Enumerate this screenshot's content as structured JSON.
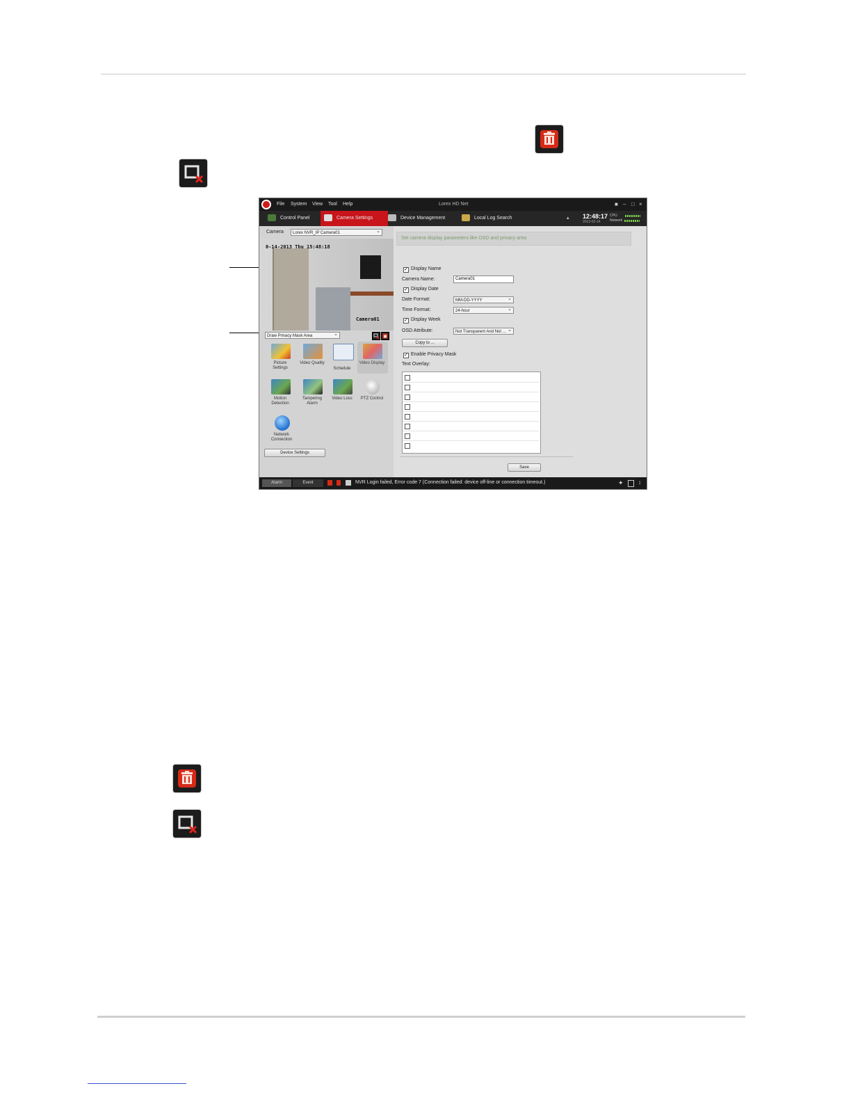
{
  "window": {
    "menu": [
      "File",
      "System",
      "View",
      "Tool",
      "Help"
    ],
    "title": "Lorex HD Net"
  },
  "nav": {
    "tabs": [
      "Control Panel",
      "Camera Settings",
      "Device Management",
      "Local Log Search"
    ],
    "active_tab": "Camera Settings",
    "clock": "12:48:17",
    "date": "2013-02-14",
    "cpu_label": "CPU",
    "network_label": "Network"
  },
  "left": {
    "camera_label": "Camera",
    "camera_value": "Lorex NVR_IP Camera01",
    "osd_timestamp": "0-14-2013 Thu 15:48:18",
    "osd_camera_name": "Camera01",
    "draw_mode": "Draw Privacy Mask Area",
    "tiles": [
      "Picture Settings",
      "Video Quality",
      "Schedule",
      "Video Display",
      "Motion Detection",
      "Tampering Alarm",
      "Video Loss",
      "PTZ Control",
      "Network Connection"
    ],
    "device_settings": "Device Settings"
  },
  "right": {
    "hint": "Set camera display parameters like OSD and privacy area",
    "display_name": "Display Name",
    "camera_name_label": "Camera Name:",
    "camera_name_value": "Camera01",
    "display_date": "Display Date",
    "date_format_label": "Date Format:",
    "date_format_value": "MM-DD-YYYY",
    "time_format_label": "Time Format:",
    "time_format_value": "24-hour",
    "display_week": "Display Week",
    "osd_attribute_label": "OSD Attribute:",
    "osd_attribute_value": "Not Transparent And Not ...",
    "copy_to": "Copy to ...",
    "enable_privacy_mask": "Enable Privacy Mask",
    "text_overlay_label": "Text Overlay:",
    "save": "Save"
  },
  "status": {
    "alarm_tab": "Alarm",
    "event_tab": "Event",
    "message": "NVR Login failed, Error code 7 (Connection failed: device off-line or connection timeout.)"
  },
  "colors": {
    "accent_red": "#c8141b",
    "dark_bar": "#1a1a1a"
  },
  "icons": {
    "delete": "trash-icon",
    "clear": "clear-x-icon"
  }
}
